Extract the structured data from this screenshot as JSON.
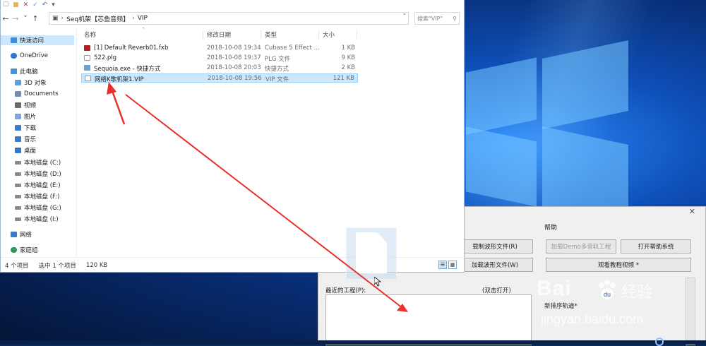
{
  "explorer": {
    "qat_icons": [
      "checkbox-icon",
      "folder-icon",
      "delete-icon",
      "properties-icon",
      "undo-icon",
      "dropdown-icon"
    ],
    "nav": {
      "back": "←",
      "forward": "→",
      "recent": "˅",
      "up": "↑"
    },
    "address": {
      "root": "Seq机架【芯鱼音频】",
      "separator": "›",
      "current": "VIP",
      "dropdown": "˅"
    },
    "search": {
      "placeholder": "搜索\"VIP\"",
      "icon": "search-icon"
    },
    "sidebar": {
      "items": [
        {
          "label": "快速访问",
          "icon": "star-icon"
        },
        {
          "label": "OneDrive",
          "icon": "cloud-icon"
        },
        {
          "label": "此电脑",
          "icon": "computer-icon"
        },
        {
          "label": "3D 对象",
          "icon": "cube-icon"
        },
        {
          "label": "Documents",
          "icon": "documents-icon"
        },
        {
          "label": "视频",
          "icon": "video-icon"
        },
        {
          "label": "图片",
          "icon": "pictures-icon"
        },
        {
          "label": "下载",
          "icon": "download-icon"
        },
        {
          "label": "音乐",
          "icon": "music-icon"
        },
        {
          "label": "桌面",
          "icon": "desktop-icon"
        },
        {
          "label": "本地磁盘 (C:)",
          "icon": "drive-icon"
        },
        {
          "label": "本地磁盘 (D:)",
          "icon": "drive-icon"
        },
        {
          "label": "本地磁盘 (E:)",
          "icon": "drive-icon"
        },
        {
          "label": "本地磁盘 (F:)",
          "icon": "drive-icon"
        },
        {
          "label": "本地磁盘 (G:)",
          "icon": "drive-icon"
        },
        {
          "label": "本地磁盘 (I:)",
          "icon": "drive-icon"
        },
        {
          "label": "网络",
          "icon": "network-icon"
        },
        {
          "label": "家庭组",
          "icon": "homegroup-icon"
        }
      ]
    },
    "columns": {
      "name": "名称",
      "modified": "修改日期",
      "type": "类型",
      "size": "大小"
    },
    "files": [
      {
        "name": "[1] Default Reverb01.fxb",
        "modified": "2018-10-08 19:34",
        "type": "Cubase 5 Effect ...",
        "size": "1 KB",
        "icon": "fxb-file-icon"
      },
      {
        "name": "522.plg",
        "modified": "2018-10-08 19:37",
        "type": "PLG 文件",
        "size": "9 KB",
        "icon": "file-icon"
      },
      {
        "name": "Sequoia.exe - 快捷方式",
        "modified": "2018-10-08 20:03",
        "type": "快捷方式",
        "size": "2 KB",
        "icon": "shortcut-icon"
      },
      {
        "name": "网络K歌机架1.VIP",
        "modified": "2018-10-08 19:56",
        "type": "VIP 文件",
        "size": "121 KB",
        "icon": "file-icon",
        "selected": true
      }
    ],
    "status": {
      "count": "4 个项目",
      "selected": "选中 1 个项目",
      "size": "120 KB"
    }
  },
  "app": {
    "close": "✕",
    "help_label": "帮助",
    "buttons": {
      "load_wave_r": "载制波形文件(R)",
      "load_wave_w": "加载波形文件(W)",
      "load_demo": "加载Demo多音轨工程",
      "open_help": "打开帮助系统",
      "watch_video": "观看教程视频 *"
    },
    "recent_label": "最近的工程(P):",
    "double_click_label": "(双击打开)",
    "side_text": "新排序轨道*"
  },
  "watermark": {
    "brand": "Bai",
    "brand2": "du",
    "cn": "经验",
    "url": "jingyan.baidu.com"
  },
  "colors": {
    "arrow": "#e8312b",
    "selection": "#cce8ff",
    "desktop": "#0e4fb8"
  }
}
